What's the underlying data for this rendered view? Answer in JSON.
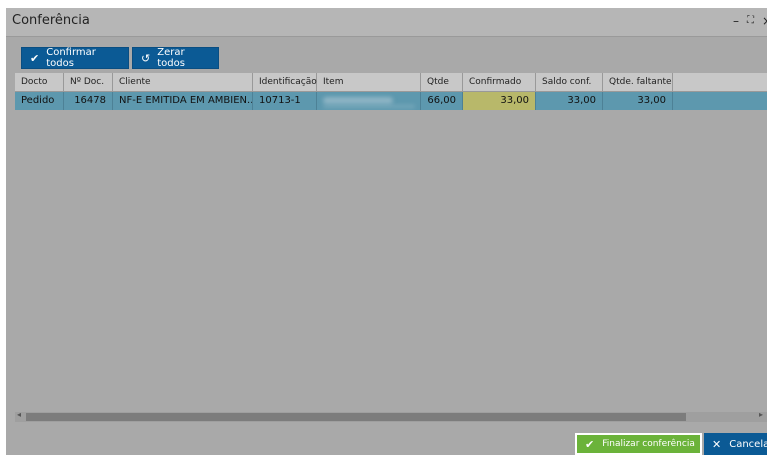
{
  "window": {
    "title": "Conferência",
    "controls": {
      "minimize": "–",
      "maximize": "⛶",
      "close": "×"
    }
  },
  "toolbar": {
    "confirm_all": "Confirmar todos",
    "reset_all": "Zerar todos"
  },
  "table": {
    "columns": [
      "Docto",
      "Nº Doc.",
      "Cliente",
      "Identificação",
      "Item",
      "Qtde",
      "Confirmado",
      "Saldo conf.",
      "Qtde. faltante"
    ],
    "rows": [
      {
        "docto": "Pedido",
        "num_doc": "16478",
        "cliente": "NF-E EMITIDA EM AMBIEN...",
        "identificacao": "10713-1",
        "qtde": "66,00",
        "confirmado": "33,00",
        "saldo_conf": "33,00",
        "qtde_faltante": "33,00"
      }
    ]
  },
  "footer": {
    "finalize": "Finalizar conferência",
    "cancel": "Cancelar"
  },
  "icons": {
    "check": "✔",
    "undo": "↺",
    "close": "✕",
    "arrow_left": "◂",
    "arrow_right": "▸"
  },
  "colors": {
    "primary_button": "#0b5a95",
    "success_button": "#6bb33a",
    "selected_row": "#5d98ae",
    "editing_cell": "#b8b86a"
  }
}
